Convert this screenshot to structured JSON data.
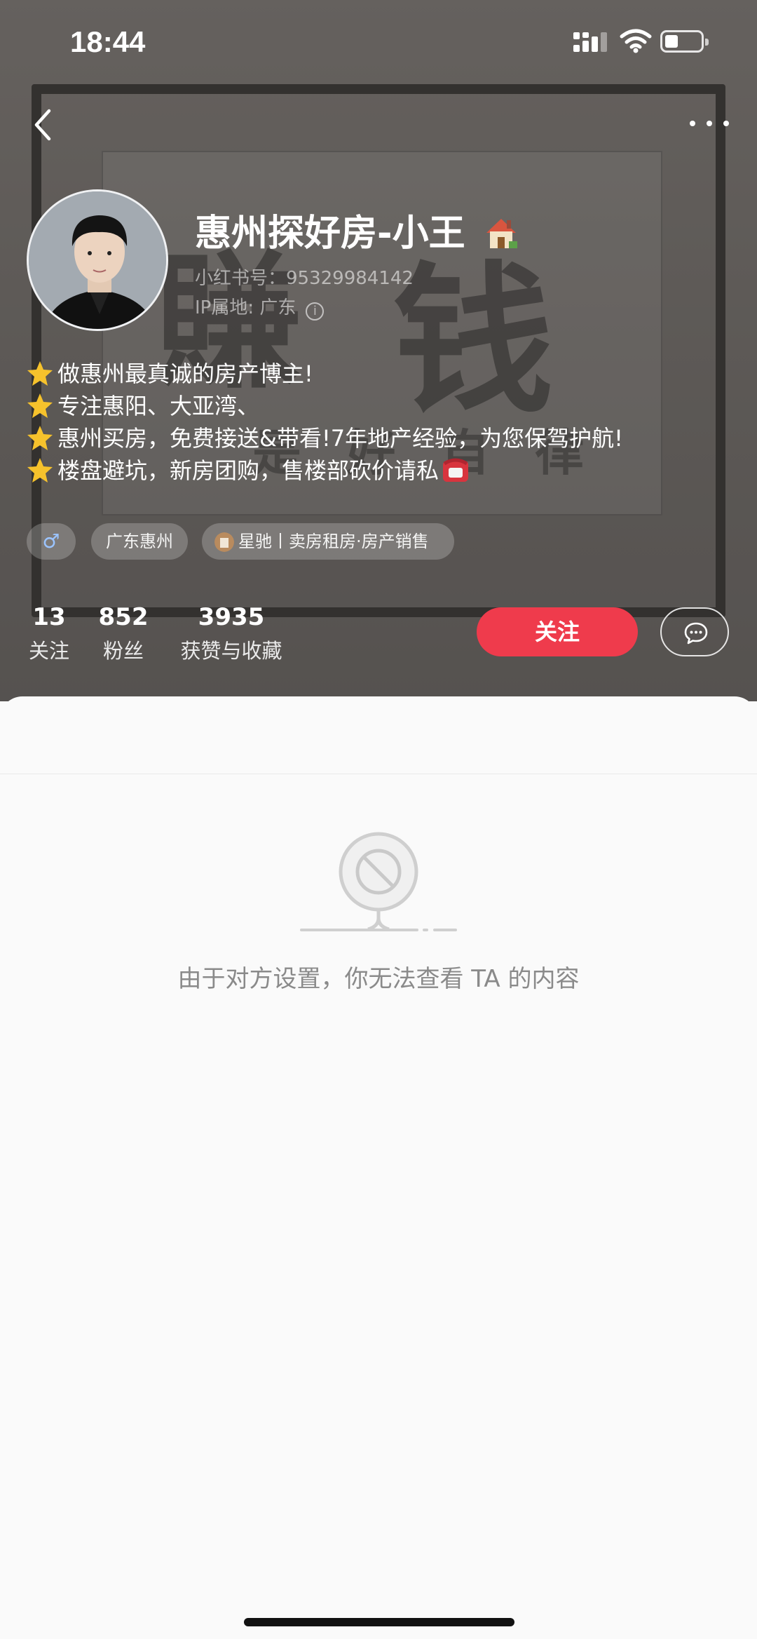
{
  "status_bar": {
    "time": "18:44"
  },
  "profile": {
    "name": "惠州探好房-小王",
    "red_id": "小红书号：95329984142",
    "ip_location": "IP属地: 广东",
    "bio": [
      "做惠州最真诚的房产博主!",
      "专注惠阳、大亚湾、",
      "惠州买房，免费接送&带看!7年地产经验，为您保驾护航!",
      "楼盘避坑，新房团购，售楼部砍价请私"
    ],
    "tags": {
      "gender": "♂",
      "location": "广东惠州",
      "job": "星驰丨卖房租房·房产销售"
    }
  },
  "stats": [
    {
      "num": "13",
      "label": "关注"
    },
    {
      "num": "852",
      "label": "粉丝"
    },
    {
      "num": "3935",
      "label": "获赞与收藏"
    }
  ],
  "actions": {
    "follow_label": "关注"
  },
  "empty_state": {
    "message": "由于对方设置，你无法查看 TA 的内容"
  },
  "colors": {
    "accent": "#ef3b4c",
    "gender_male": "#9bc4ff"
  },
  "icons": [
    "back-chevron-icon",
    "more-dots-icon",
    "house-emoji-icon",
    "star-emoji-icon",
    "telephone-emoji-icon",
    "info-icon",
    "chat-bubble-icon",
    "blocked-content-icon"
  ]
}
